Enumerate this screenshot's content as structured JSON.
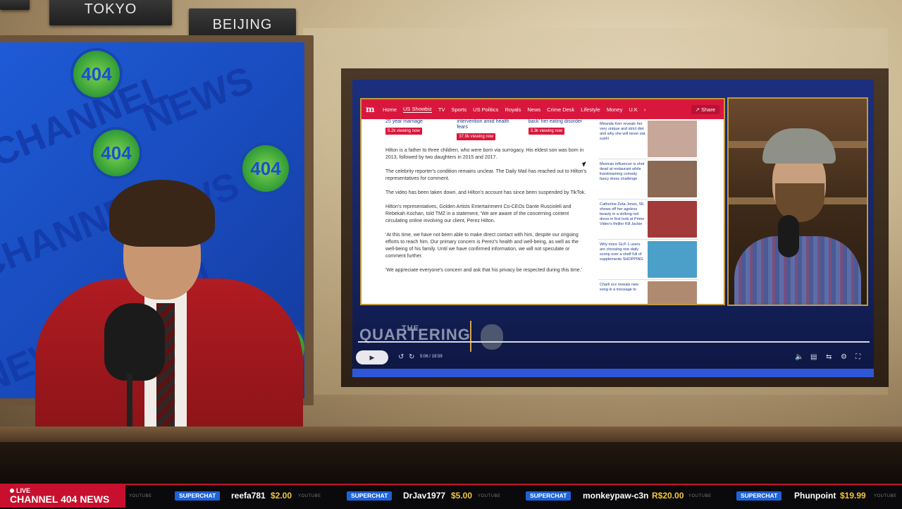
{
  "studio": {
    "city_signs": [
      "TOKYO",
      "BEIJING"
    ],
    "background_words": [
      "CHANNEL",
      "NEWS",
      "CHANNEL",
      "NEWS",
      "CHANNEL",
      "NEWS"
    ],
    "badge_text": "404"
  },
  "browser": {
    "nav": {
      "items": [
        "Home",
        "US Showbiz",
        "TV",
        "Sports",
        "US Politics",
        "Royals",
        "News",
        "Crime Desk",
        "Lifestyle",
        "Money",
        "U.K"
      ],
      "active": "US Showbiz",
      "more_icon": "chevron-right-icon",
      "share_label": "Share"
    },
    "top_stories": [
      {
        "title": "25 year marriage",
        "views": "5.2k viewing now"
      },
      {
        "title": "intervention amid health fears",
        "views": "37.9k viewing now"
      },
      {
        "title": "back' her eating disorder",
        "views": "3.3k viewing now"
      }
    ],
    "paragraphs": [
      "Hilton is a father to three children, who were born via surrogacy. His eldest son was born in 2013, followed by two daughters in 2015 and 2017.",
      "The celebrity reporter's condition remains unclear. The Daily Mail has reached out to Hilton's representatives for comment.",
      "The video has been taken down, and Hilton's account has since been suspended by TikTok.",
      "Hilton's representatives, Golden Artists Entertainment Co-CEOs Dante Ruscioleli and Rebekah Kochan, told TMZ in a statement, 'We are aware of the concerning content circulating online involving our client, Perez Hilton.",
      "'At this time, we have not been able to make direct contact with him, despite our ongoing efforts to reach him. Our primary concern is Perez's health and well-being, as well as the well-being of his family. Until we have confirmed information, we will not speculate or comment further.",
      "'We appreciate everyone's concern and ask that his privacy be respected during this time.'"
    ],
    "sidebar": [
      {
        "text": "Miranda Kerr reveals her very unique and strict diet and why she will never eat sushi",
        "color": "#c7a79a"
      },
      {
        "text": "Mexican influencer is shot dead at restaurant while livestreaming comedy fancy dress challenge",
        "color": "#8a6a55"
      },
      {
        "text": "Catherine Zeta-Jones, 56, shows off her ageless beauty in a striking red dress in first look at Prime Video's thriller Kill Jackie",
        "color": "#a33a3a"
      },
      {
        "text": "Why more GLP-1 users are choosing one daily scoop over a shelf full of supplements SHOPPING",
        "color": "#4aa0c8"
      },
      {
        "text": "Charli xcx reveals new song is a message to",
        "color": "#b08a70"
      }
    ]
  },
  "player": {
    "brand": "QUARTERING",
    "brand_prefix": "THE",
    "play_icon": "play-icon",
    "time": "5:06 / 19:59"
  },
  "ticker": {
    "live_label": "LIVE",
    "channel_label": "CHANNEL 404 NEWS",
    "source_tag": "YOUTUBE",
    "badge_label": "SUPERCHAT",
    "superchats": [
      {
        "user": "reefa781",
        "amount": "$2.00"
      },
      {
        "user": "DrJav1977",
        "amount": "$5.00"
      },
      {
        "user": "monkeypaw-c3n",
        "amount": "R$20.00"
      },
      {
        "user": "Phunpoint",
        "amount": "$19.99"
      }
    ]
  },
  "colors": {
    "ticker_red": "#c8102e",
    "superchat_blue": "#1e62d8",
    "amount_gold": "#f3c533",
    "nav_red": "#d9173d"
  }
}
